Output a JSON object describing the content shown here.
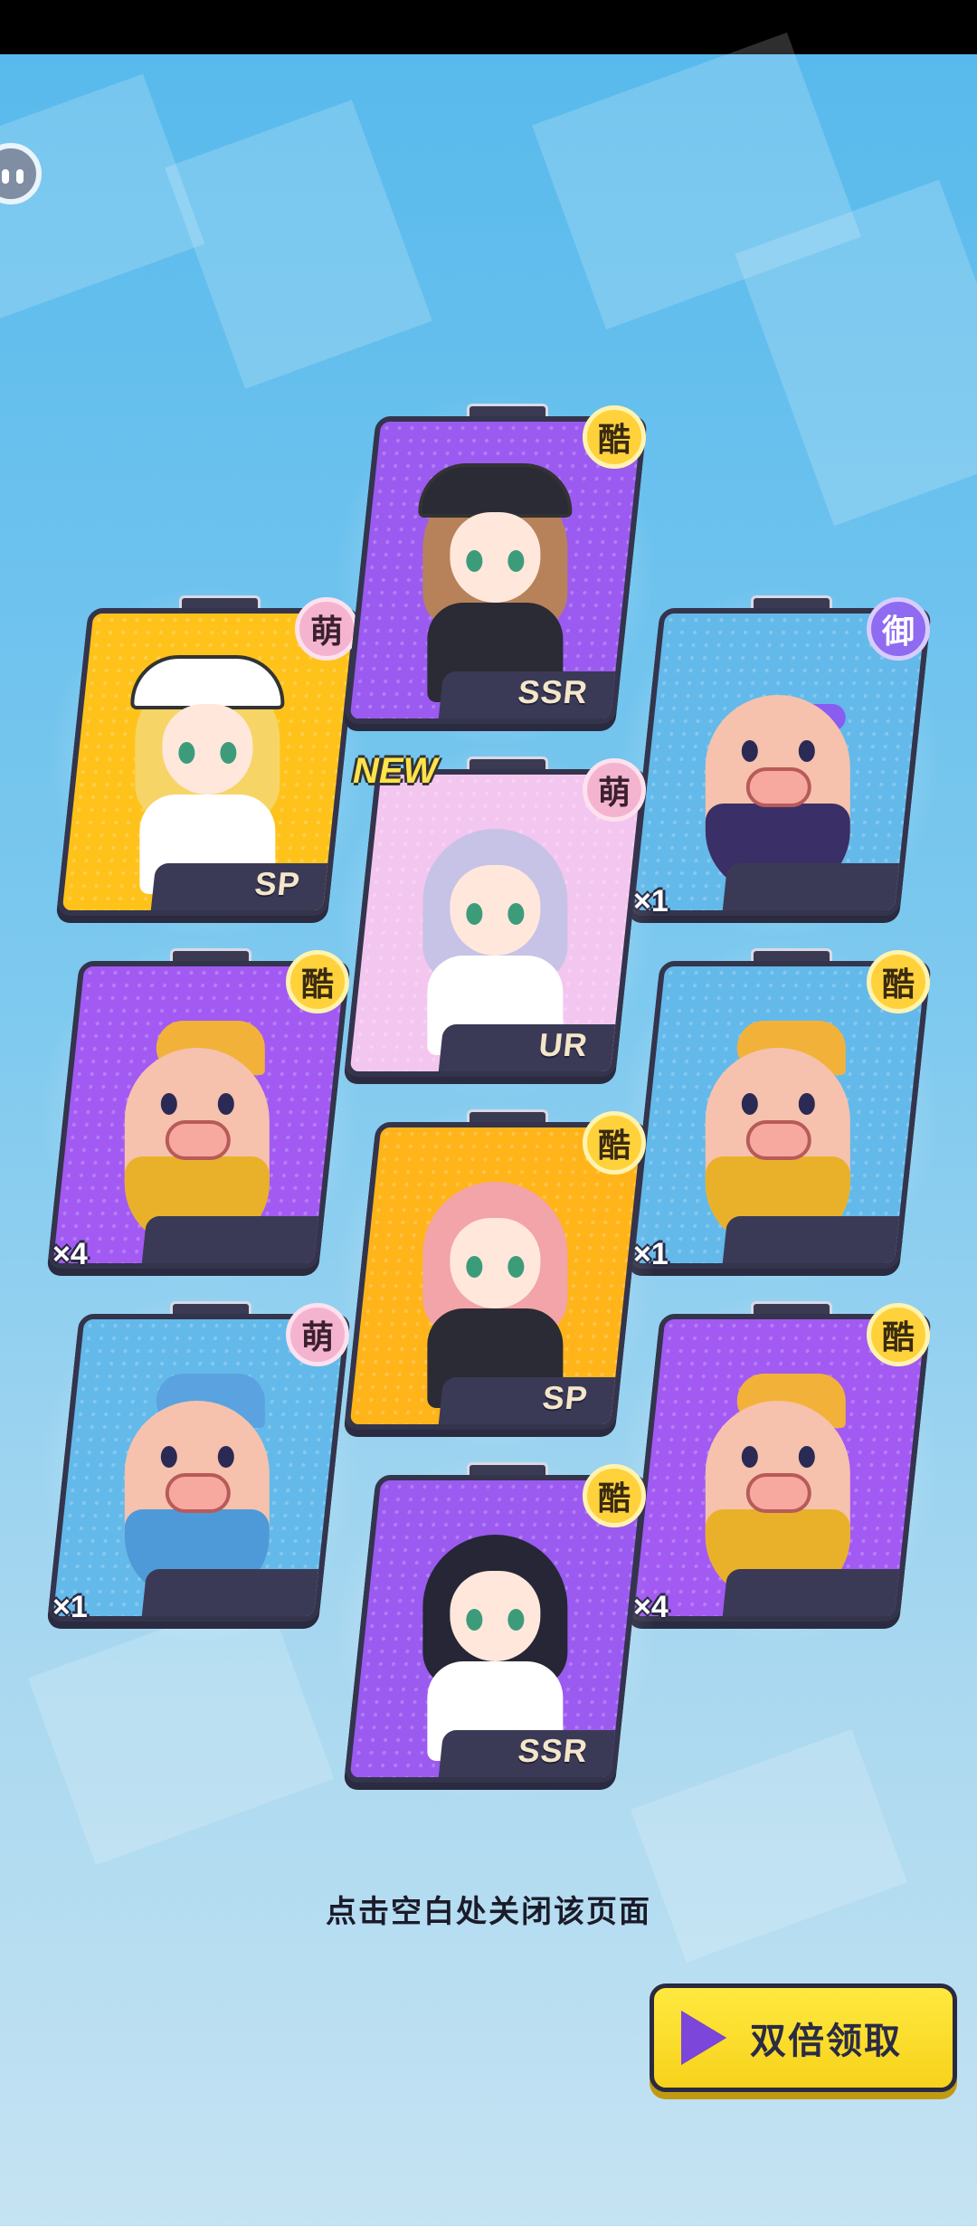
{
  "cards": [
    {
      "id": "left-1",
      "attribute": "萌",
      "attr_type": "cute",
      "rarity": "SP",
      "count": "",
      "is_new": false,
      "bg": "#ffc21a",
      "kind": "girl",
      "hair": "#f7d466",
      "outfit": "#ffffff",
      "hat": "#ffffff"
    },
    {
      "id": "center-1",
      "attribute": "酷",
      "attr_type": "cool",
      "rarity": "SSR",
      "count": "",
      "is_new": false,
      "bg": "#9b5af0",
      "kind": "girl",
      "hair": "#b7825a",
      "outfit": "#2b2b35",
      "hat": "#2b2b35"
    },
    {
      "id": "right-1",
      "attribute": "御",
      "attr_type": "elegant",
      "rarity": "",
      "count": "×1",
      "is_new": false,
      "bg": "#63b9ea",
      "kind": "pig",
      "cloth": "#3a2f66",
      "cap": ""
    },
    {
      "id": "center-2",
      "attribute": "萌",
      "attr_type": "cute",
      "rarity": "UR",
      "count": "",
      "is_new": true,
      "bg": "#f3c6f0",
      "kind": "girl",
      "hair": "#c7c3e6",
      "outfit": "#ffffff",
      "hat": ""
    },
    {
      "id": "left-2",
      "attribute": "酷",
      "attr_type": "cool",
      "rarity": "",
      "count": "×4",
      "is_new": false,
      "bg": "#a25af2",
      "kind": "pig",
      "cloth": "#e9b12a",
      "cap": "#f2b23a"
    },
    {
      "id": "right-2",
      "attribute": "酷",
      "attr_type": "cool",
      "rarity": "",
      "count": "×1",
      "is_new": false,
      "bg": "#63b9ea",
      "kind": "pig",
      "cloth": "#e9b12a",
      "cap": "#f2b23a"
    },
    {
      "id": "center-3",
      "attribute": "酷",
      "attr_type": "cool",
      "rarity": "SP",
      "count": "",
      "is_new": false,
      "bg": "#ffb41a",
      "kind": "girl",
      "hair": "#f2a4a8",
      "outfit": "#2b2b35",
      "hat": ""
    },
    {
      "id": "left-3",
      "attribute": "萌",
      "attr_type": "cute",
      "rarity": "",
      "count": "×1",
      "is_new": false,
      "bg": "#63b9ea",
      "kind": "pig",
      "cloth": "#4e9ad8",
      "cap": "#5aa3e0"
    },
    {
      "id": "right-3",
      "attribute": "酷",
      "attr_type": "cool",
      "rarity": "",
      "count": "×4",
      "is_new": false,
      "bg": "#a25af2",
      "kind": "pig",
      "cloth": "#e9b12a",
      "cap": "#f2b23a"
    },
    {
      "id": "center-4",
      "attribute": "酷",
      "attr_type": "cool",
      "rarity": "SSR",
      "count": "",
      "is_new": false,
      "bg": "#9b5af0",
      "kind": "girl",
      "hair": "#262636",
      "outfit": "#ffffff",
      "hat": ""
    }
  ],
  "new_label": "NEW",
  "close_hint": "点击空白处关闭该页面",
  "double_claim_label": "双倍领取",
  "colors": {
    "accent_yellow": "#ffe93f",
    "play_icon": "#7b46d9",
    "card_border": "#34344c"
  }
}
